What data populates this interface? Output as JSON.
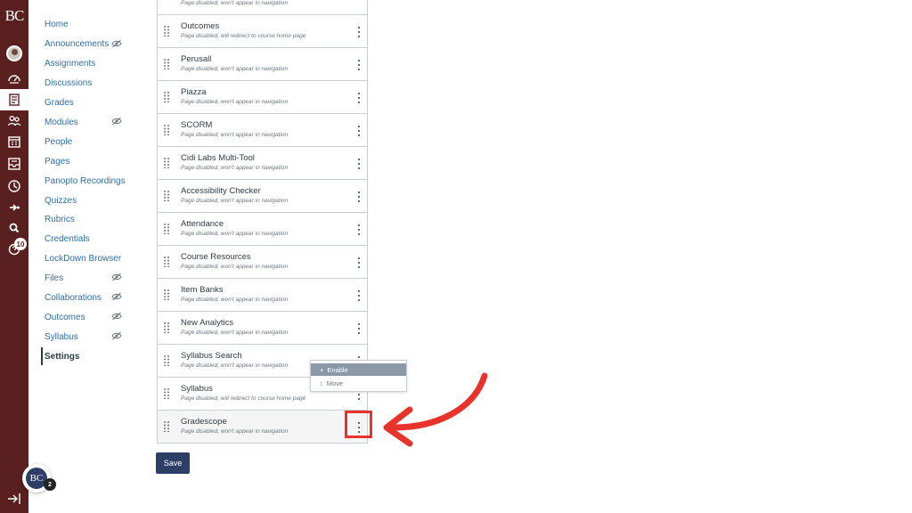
{
  "global_nav": {
    "logo_text": "BC",
    "inbox_badge": "10",
    "icons": [
      "account-avatar-icon",
      "dashboard-icon",
      "courses-icon",
      "groups-icon",
      "calendar-icon",
      "inbox-icon",
      "history-icon",
      "commons-icon",
      "studio-icon",
      "help-icon"
    ]
  },
  "course_nav": {
    "items": [
      {
        "label": "Home",
        "hidden": false
      },
      {
        "label": "Announcements",
        "hidden": true
      },
      {
        "label": "Assignments",
        "hidden": false
      },
      {
        "label": "Discussions",
        "hidden": false
      },
      {
        "label": "Grades",
        "hidden": false
      },
      {
        "label": "Modules",
        "hidden": true
      },
      {
        "label": "People",
        "hidden": false
      },
      {
        "label": "Pages",
        "hidden": false
      },
      {
        "label": "Panopto Recordings",
        "hidden": false
      },
      {
        "label": "Quizzes",
        "hidden": false
      },
      {
        "label": "Rubrics",
        "hidden": false
      },
      {
        "label": "Credentials",
        "hidden": false
      },
      {
        "label": "LockDown Browser",
        "hidden": false
      },
      {
        "label": "Files",
        "hidden": true
      },
      {
        "label": "Collaborations",
        "hidden": true
      },
      {
        "label": "Outcomes",
        "hidden": true
      },
      {
        "label": "Syllabus",
        "hidden": true
      },
      {
        "label": "Settings",
        "hidden": false,
        "active": true
      }
    ]
  },
  "disabled_items": [
    {
      "title": "",
      "status": "Page disabled, won't appear in navigation"
    },
    {
      "title": "Outcomes",
      "status": "Page disabled, will redirect to course home page"
    },
    {
      "title": "Perusall",
      "status": "Page disabled, won't appear in navigation"
    },
    {
      "title": "Piazza",
      "status": "Page disabled, won't appear in navigation"
    },
    {
      "title": "SCORM",
      "status": "Page disabled, won't appear in navigation"
    },
    {
      "title": "Cidi Labs Multi-Tool",
      "status": "Page disabled, won't appear in navigation"
    },
    {
      "title": "Accessibility Checker",
      "status": "Page disabled, won't appear in navigation"
    },
    {
      "title": "Attendance",
      "status": "Page disabled, won't appear in navigation"
    },
    {
      "title": "Course Resources",
      "status": "Page disabled, won't appear in navigation"
    },
    {
      "title": "Item Banks",
      "status": "Page disabled, won't appear in navigation"
    },
    {
      "title": "New Analytics",
      "status": "Page disabled, won't appear in navigation"
    },
    {
      "title": "Syllabus Search",
      "status": "Page disabled, won't appear in navigation"
    },
    {
      "title": "Syllabus",
      "status": "Page disabled, will redirect to course home page"
    },
    {
      "title": "Gradescope",
      "status": "Page disabled, won't appear in navigation"
    }
  ],
  "context_menu": {
    "enable_label": "Enable",
    "move_label": "Move"
  },
  "save_label": "Save",
  "floating": {
    "logo_text": "BC",
    "badge": "2"
  },
  "colors": {
    "nav_bg": "#5a1f1f",
    "link": "#2d6ea8",
    "save_bg": "#2d3f66",
    "annotation": "#e8332a"
  }
}
